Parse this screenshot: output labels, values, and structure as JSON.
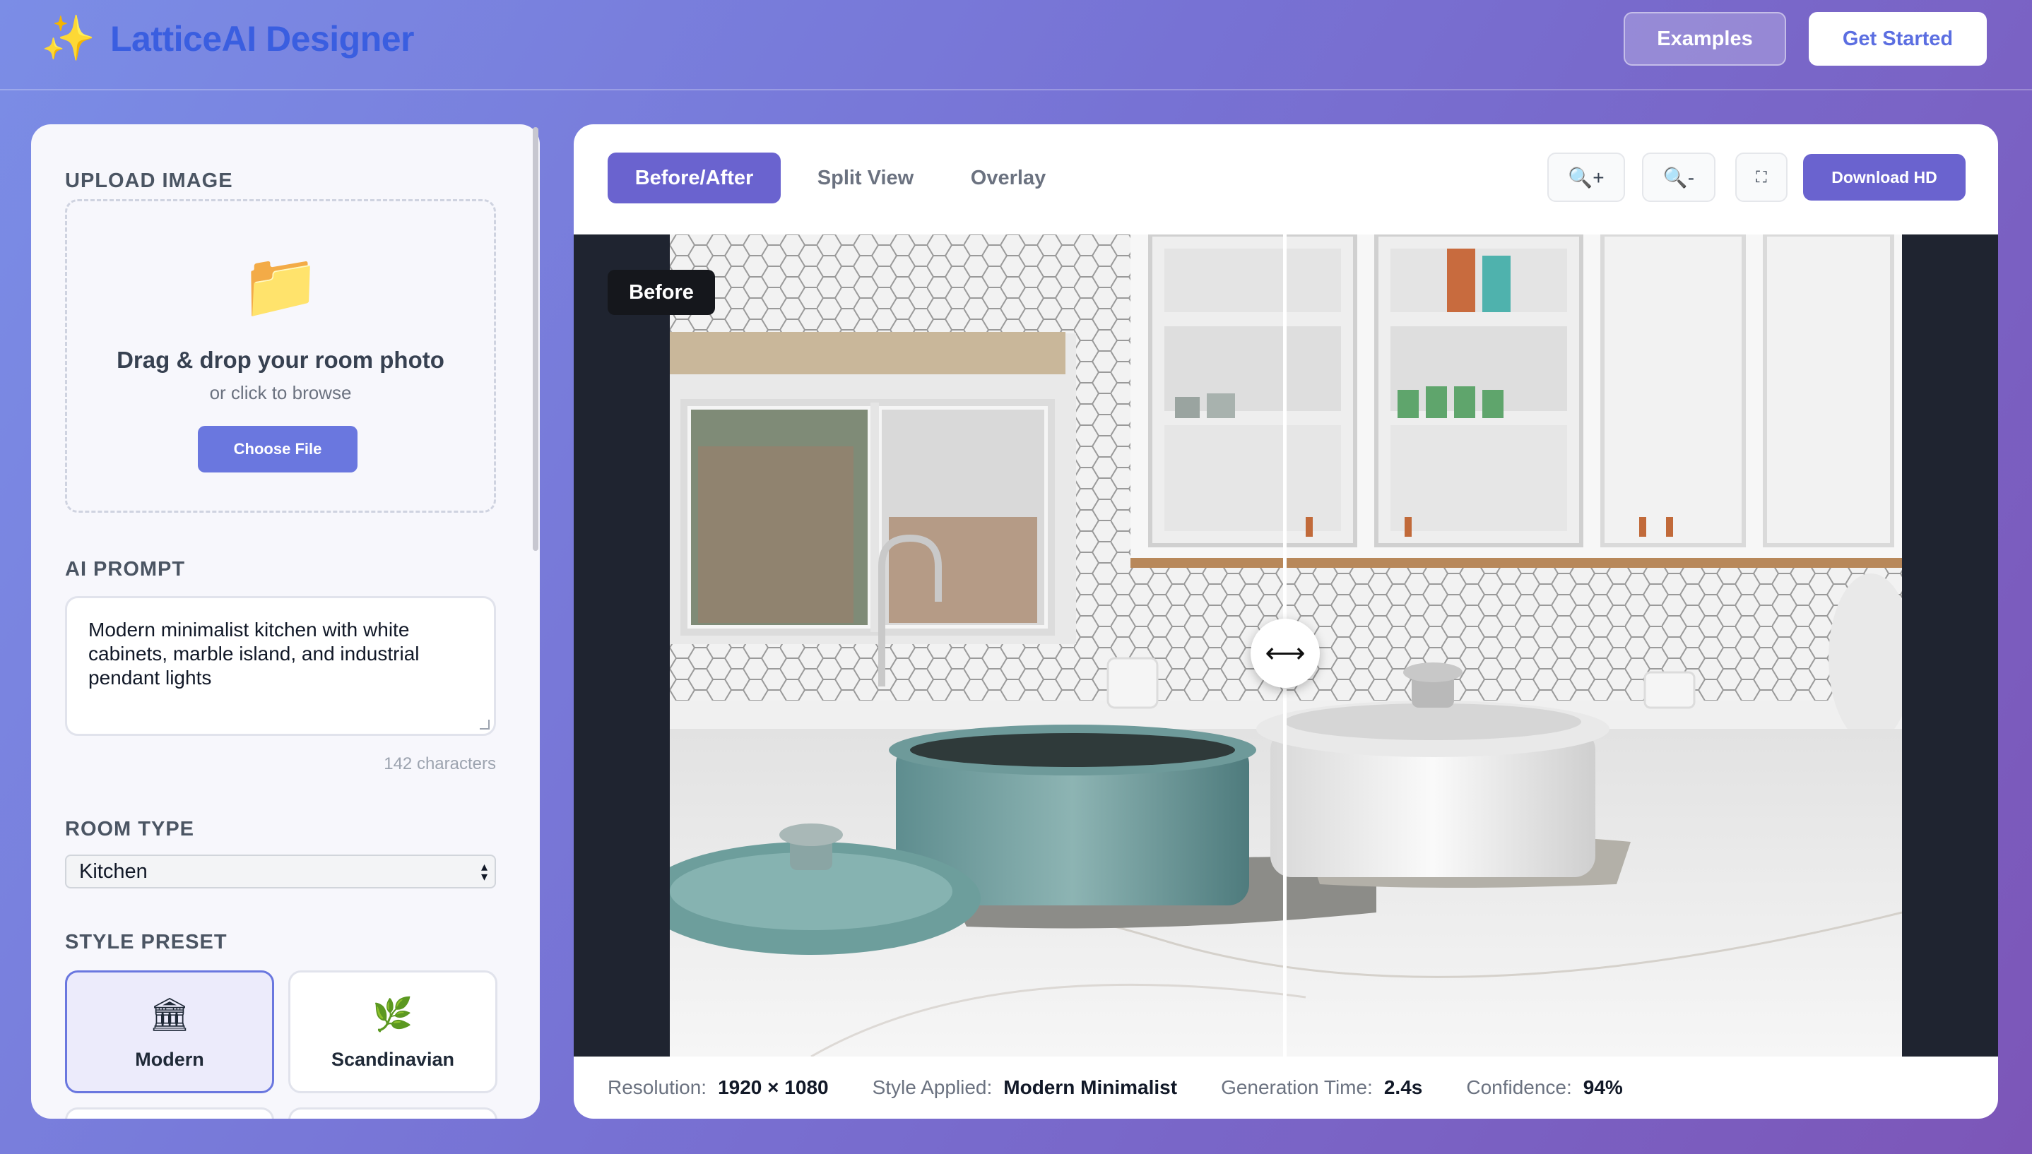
{
  "header": {
    "logo_icon": "✨",
    "app_name": "LatticeAI Designer",
    "examples_label": "Examples",
    "get_started_label": "Get Started"
  },
  "sidebar": {
    "upload": {
      "section_label": "UPLOAD IMAGE",
      "folder_icon": "📁",
      "title": "Drag & drop your room photo",
      "subtitle": "or click to browse",
      "button_label": "Choose File"
    },
    "prompt": {
      "section_label": "AI PROMPT",
      "value": "Modern minimalist kitchen with white cabinets, marble island, and industrial pendant lights",
      "char_count": "142 characters"
    },
    "room_type": {
      "section_label": "ROOM TYPE",
      "selected": "Kitchen"
    },
    "style_preset": {
      "section_label": "STYLE PRESET",
      "options": [
        {
          "label": "Modern",
          "icon": "🏛",
          "active": true
        },
        {
          "label": "Scandinavian",
          "icon": "🌿",
          "active": false
        }
      ]
    }
  },
  "viewer": {
    "tabs": [
      {
        "label": "Before/After",
        "active": true
      },
      {
        "label": "Split View",
        "active": false
      },
      {
        "label": "Overlay",
        "active": false
      }
    ],
    "tools": {
      "zoom_in": "🔍+",
      "zoom_out": "🔍-",
      "fullscreen": "⛶",
      "download_label": "Download HD"
    },
    "before_label": "Before",
    "slider_icon": "⟷",
    "footer": {
      "resolution_label": "Resolution:",
      "resolution_value": "1920 × 1080",
      "style_label": "Style Applied:",
      "style_value": "Modern Minimalist",
      "time_label": "Generation Time:",
      "time_value": "2.4s",
      "confidence_label": "Confidence:",
      "confidence_value": "94%"
    }
  }
}
